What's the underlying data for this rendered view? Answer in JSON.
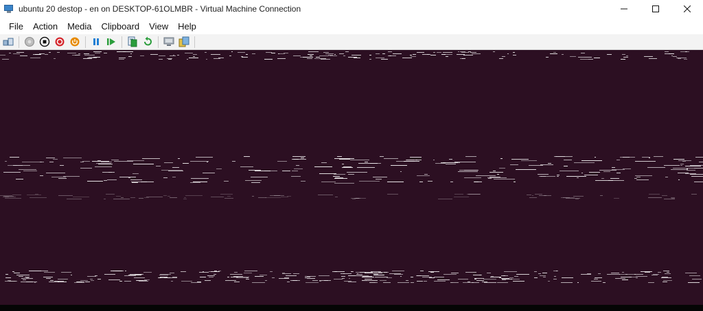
{
  "window": {
    "title": "ubuntu 20 destop - en on DESKTOP-61OLMBR - Virtual Machine Connection",
    "app_icon": "virtual-machine-connection-icon",
    "controls": [
      {
        "name": "minimize-button",
        "glyph": "—"
      },
      {
        "name": "maximize-button",
        "glyph": "☐"
      },
      {
        "name": "close-button",
        "glyph": "✕"
      }
    ]
  },
  "menu": {
    "items": [
      "File",
      "Action",
      "Media",
      "Clipboard",
      "View",
      "Help"
    ]
  },
  "toolbar": {
    "buttons": [
      {
        "name": "ctrl-alt-del-button",
        "icon": "ctrl-alt-del-icon"
      },
      {
        "name": "start-button",
        "icon": "start-icon",
        "color": "#9a9a9a"
      },
      {
        "name": "turn-off-button",
        "icon": "stop-icon",
        "color": "#111111"
      },
      {
        "name": "shut-down-button",
        "icon": "shutdown-icon",
        "color": "#d4262c"
      },
      {
        "name": "save-button",
        "icon": "power-icon",
        "color": "#e78a00"
      },
      {
        "name": "pause-button",
        "icon": "pause-icon",
        "color": "#1e7fd4"
      },
      {
        "name": "resume-button",
        "icon": "resume-icon",
        "color": "#2a9d3b"
      },
      {
        "name": "checkpoint-button",
        "icon": "checkpoint-icon"
      },
      {
        "name": "revert-button",
        "icon": "revert-icon",
        "color": "#2a9d3b"
      },
      {
        "name": "enhanced-session-button",
        "icon": "enhanced-session-icon"
      },
      {
        "name": "share-button",
        "icon": "share-icon"
      }
    ]
  },
  "vm_screen": {
    "background": "#2c0f22",
    "noise_color": "#ffffff"
  }
}
